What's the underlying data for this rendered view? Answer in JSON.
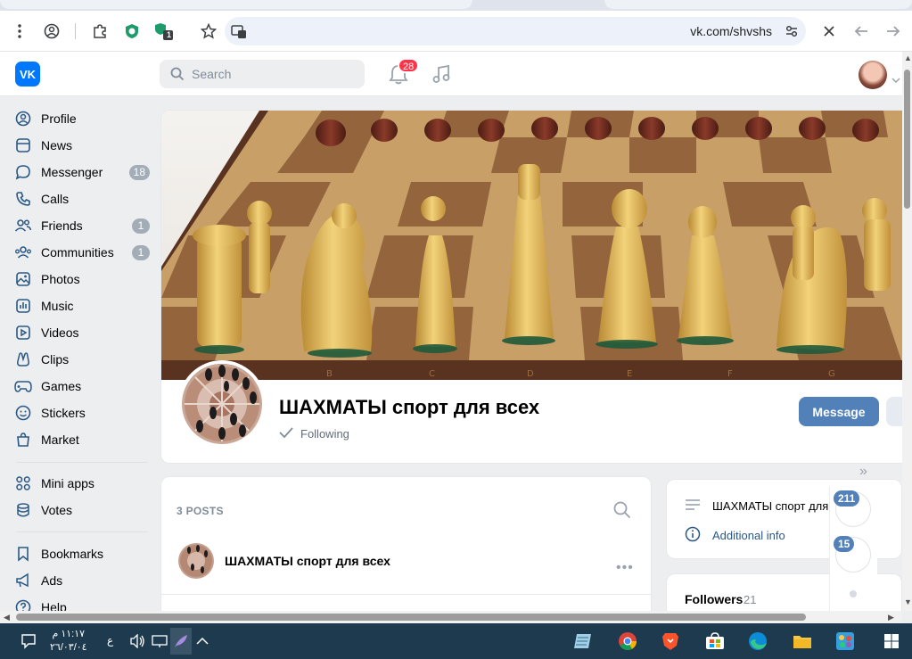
{
  "browser": {
    "url": "vk.com/shvshs",
    "extension_badge": "1"
  },
  "header": {
    "logo_text": "VK",
    "search_placeholder": "Search",
    "notifications_count": "28"
  },
  "sidebar": {
    "items": [
      {
        "label": "Profile",
        "icon": "profile-icon"
      },
      {
        "label": "News",
        "icon": "news-icon"
      },
      {
        "label": "Messenger",
        "icon": "messenger-icon",
        "count": "18"
      },
      {
        "label": "Calls",
        "icon": "phone-icon"
      },
      {
        "label": "Friends",
        "icon": "friends-icon",
        "count": "1"
      },
      {
        "label": "Communities",
        "icon": "communities-icon",
        "count": "1"
      },
      {
        "label": "Photos",
        "icon": "photos-icon"
      },
      {
        "label": "Music",
        "icon": "music-icon"
      },
      {
        "label": "Videos",
        "icon": "videos-icon"
      },
      {
        "label": "Clips",
        "icon": "clips-icon"
      },
      {
        "label": "Games",
        "icon": "games-icon"
      },
      {
        "label": "Stickers",
        "icon": "stickers-icon"
      },
      {
        "label": "Market",
        "icon": "market-icon"
      }
    ],
    "items2": [
      {
        "label": "Mini apps",
        "icon": "mini-apps-icon"
      },
      {
        "label": "Votes",
        "icon": "votes-icon"
      }
    ],
    "items3": [
      {
        "label": "Bookmarks",
        "icon": "bookmarks-icon"
      },
      {
        "label": "Ads",
        "icon": "ads-icon"
      },
      {
        "label": "Help",
        "icon": "help-icon"
      }
    ]
  },
  "community": {
    "title": "ШАХМАТЫ спорт для всех",
    "following_label": "Following",
    "message_button": "Message"
  },
  "posts": {
    "count_label": "3 POSTS",
    "first_post_author": "ШАХМАТЫ спорт для всех"
  },
  "info": {
    "name_line": "ШАХМАТЫ спорт для",
    "additional_info": "Additional info",
    "followers_label": "Followers",
    "followers_count": "21"
  },
  "floating_panel": {
    "badge1": "211",
    "badge2": "15"
  },
  "taskbar": {
    "time": "١١:١٧ م",
    "date": "٢٦/٠٣/٠٤",
    "lang": "ع"
  },
  "colors": {
    "vk_blue": "#0077ff",
    "button_blue": "#5181b8",
    "badge_red": "#ff3347",
    "taskbar": "#1d3a4f"
  }
}
